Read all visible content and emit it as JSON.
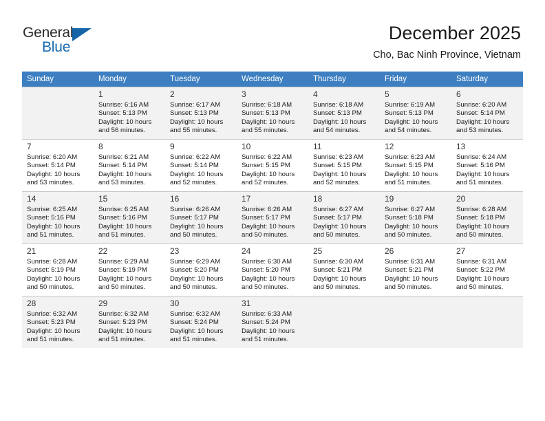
{
  "brand": {
    "name_top": "General",
    "name_bottom": "Blue",
    "accent_color": "#1569b0",
    "top_color": "#2b2b2b"
  },
  "header": {
    "title": "December 2025",
    "subtitle": "Cho, Bac Ninh Province, Vietnam"
  },
  "theme": {
    "header_row_bg": "#3d7fc1",
    "header_row_text": "#ffffff",
    "shaded_row_bg": "#f2f2f2",
    "grid_line": "#c8c8c8"
  },
  "weekdays": [
    "Sunday",
    "Monday",
    "Tuesday",
    "Wednesday",
    "Thursday",
    "Friday",
    "Saturday"
  ],
  "weeks": [
    [
      {
        "day": "",
        "detail": ""
      },
      {
        "day": "1",
        "detail": "Sunrise: 6:16 AM\nSunset: 5:13 PM\nDaylight: 10 hours\nand 56 minutes."
      },
      {
        "day": "2",
        "detail": "Sunrise: 6:17 AM\nSunset: 5:13 PM\nDaylight: 10 hours\nand 55 minutes."
      },
      {
        "day": "3",
        "detail": "Sunrise: 6:18 AM\nSunset: 5:13 PM\nDaylight: 10 hours\nand 55 minutes."
      },
      {
        "day": "4",
        "detail": "Sunrise: 6:18 AM\nSunset: 5:13 PM\nDaylight: 10 hours\nand 54 minutes."
      },
      {
        "day": "5",
        "detail": "Sunrise: 6:19 AM\nSunset: 5:13 PM\nDaylight: 10 hours\nand 54 minutes."
      },
      {
        "day": "6",
        "detail": "Sunrise: 6:20 AM\nSunset: 5:14 PM\nDaylight: 10 hours\nand 53 minutes."
      }
    ],
    [
      {
        "day": "7",
        "detail": "Sunrise: 6:20 AM\nSunset: 5:14 PM\nDaylight: 10 hours\nand 53 minutes."
      },
      {
        "day": "8",
        "detail": "Sunrise: 6:21 AM\nSunset: 5:14 PM\nDaylight: 10 hours\nand 53 minutes."
      },
      {
        "day": "9",
        "detail": "Sunrise: 6:22 AM\nSunset: 5:14 PM\nDaylight: 10 hours\nand 52 minutes."
      },
      {
        "day": "10",
        "detail": "Sunrise: 6:22 AM\nSunset: 5:15 PM\nDaylight: 10 hours\nand 52 minutes."
      },
      {
        "day": "11",
        "detail": "Sunrise: 6:23 AM\nSunset: 5:15 PM\nDaylight: 10 hours\nand 52 minutes."
      },
      {
        "day": "12",
        "detail": "Sunrise: 6:23 AM\nSunset: 5:15 PM\nDaylight: 10 hours\nand 51 minutes."
      },
      {
        "day": "13",
        "detail": "Sunrise: 6:24 AM\nSunset: 5:16 PM\nDaylight: 10 hours\nand 51 minutes."
      }
    ],
    [
      {
        "day": "14",
        "detail": "Sunrise: 6:25 AM\nSunset: 5:16 PM\nDaylight: 10 hours\nand 51 minutes."
      },
      {
        "day": "15",
        "detail": "Sunrise: 6:25 AM\nSunset: 5:16 PM\nDaylight: 10 hours\nand 51 minutes."
      },
      {
        "day": "16",
        "detail": "Sunrise: 6:26 AM\nSunset: 5:17 PM\nDaylight: 10 hours\nand 50 minutes."
      },
      {
        "day": "17",
        "detail": "Sunrise: 6:26 AM\nSunset: 5:17 PM\nDaylight: 10 hours\nand 50 minutes."
      },
      {
        "day": "18",
        "detail": "Sunrise: 6:27 AM\nSunset: 5:17 PM\nDaylight: 10 hours\nand 50 minutes."
      },
      {
        "day": "19",
        "detail": "Sunrise: 6:27 AM\nSunset: 5:18 PM\nDaylight: 10 hours\nand 50 minutes."
      },
      {
        "day": "20",
        "detail": "Sunrise: 6:28 AM\nSunset: 5:18 PM\nDaylight: 10 hours\nand 50 minutes."
      }
    ],
    [
      {
        "day": "21",
        "detail": "Sunrise: 6:28 AM\nSunset: 5:19 PM\nDaylight: 10 hours\nand 50 minutes."
      },
      {
        "day": "22",
        "detail": "Sunrise: 6:29 AM\nSunset: 5:19 PM\nDaylight: 10 hours\nand 50 minutes."
      },
      {
        "day": "23",
        "detail": "Sunrise: 6:29 AM\nSunset: 5:20 PM\nDaylight: 10 hours\nand 50 minutes."
      },
      {
        "day": "24",
        "detail": "Sunrise: 6:30 AM\nSunset: 5:20 PM\nDaylight: 10 hours\nand 50 minutes."
      },
      {
        "day": "25",
        "detail": "Sunrise: 6:30 AM\nSunset: 5:21 PM\nDaylight: 10 hours\nand 50 minutes."
      },
      {
        "day": "26",
        "detail": "Sunrise: 6:31 AM\nSunset: 5:21 PM\nDaylight: 10 hours\nand 50 minutes."
      },
      {
        "day": "27",
        "detail": "Sunrise: 6:31 AM\nSunset: 5:22 PM\nDaylight: 10 hours\nand 50 minutes."
      }
    ],
    [
      {
        "day": "28",
        "detail": "Sunrise: 6:32 AM\nSunset: 5:23 PM\nDaylight: 10 hours\nand 51 minutes."
      },
      {
        "day": "29",
        "detail": "Sunrise: 6:32 AM\nSunset: 5:23 PM\nDaylight: 10 hours\nand 51 minutes."
      },
      {
        "day": "30",
        "detail": "Sunrise: 6:32 AM\nSunset: 5:24 PM\nDaylight: 10 hours\nand 51 minutes."
      },
      {
        "day": "31",
        "detail": "Sunrise: 6:33 AM\nSunset: 5:24 PM\nDaylight: 10 hours\nand 51 minutes."
      },
      {
        "day": "",
        "detail": ""
      },
      {
        "day": "",
        "detail": ""
      },
      {
        "day": "",
        "detail": ""
      }
    ]
  ]
}
